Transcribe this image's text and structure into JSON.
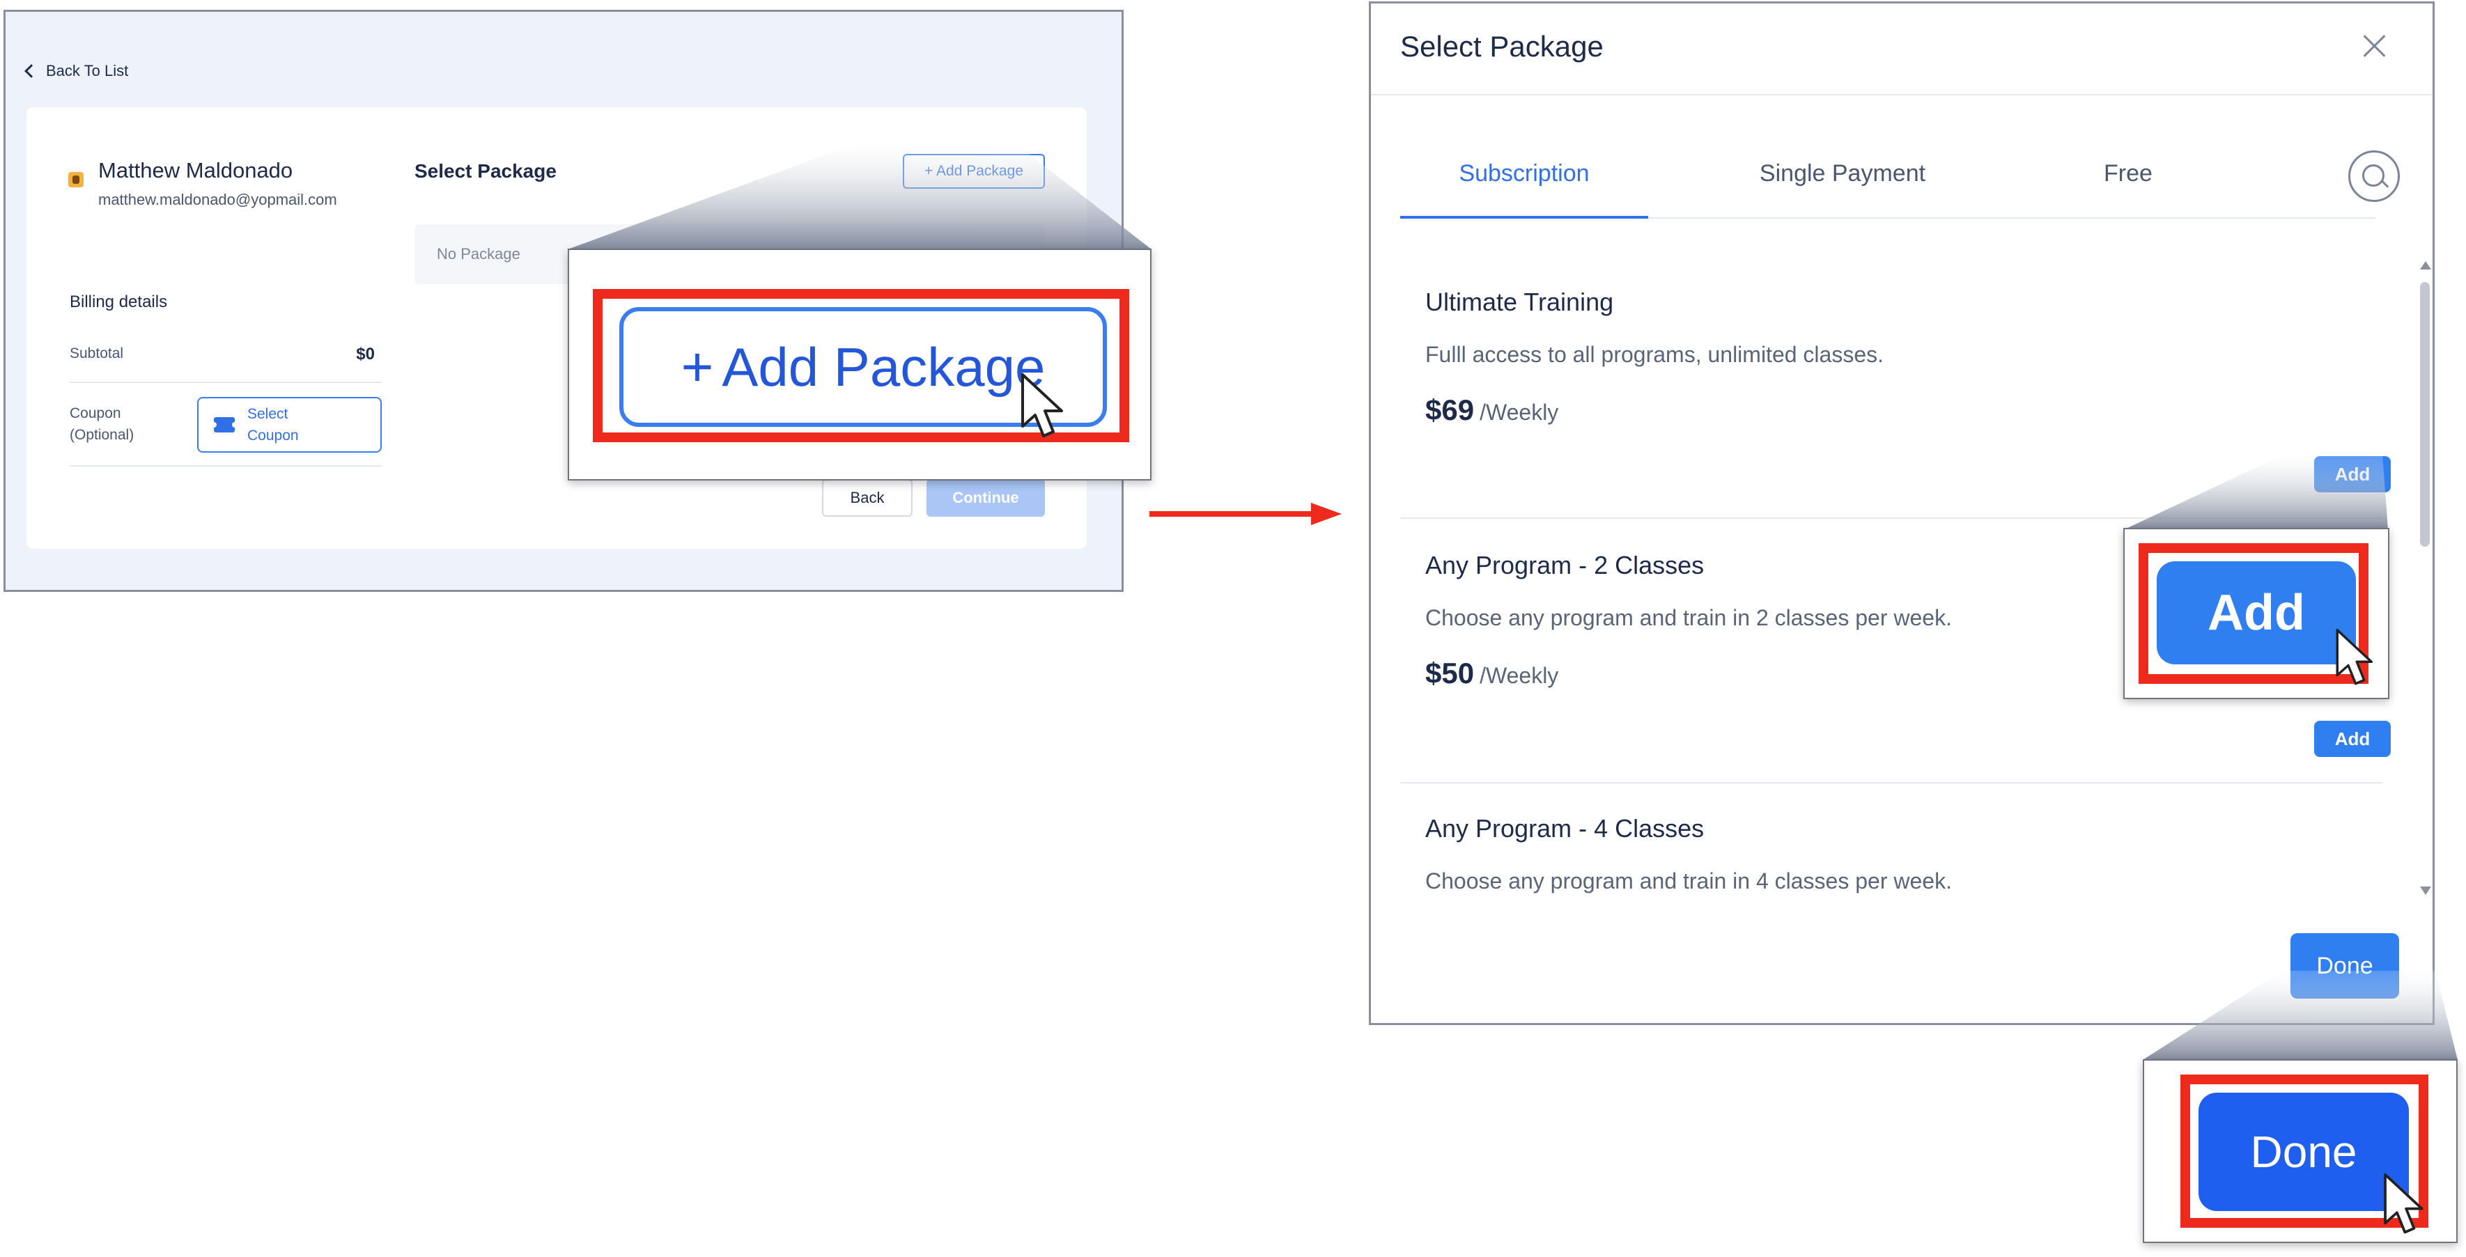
{
  "left_screen": {
    "back_link": "Back To List",
    "user": {
      "name": "Matthew Maldonado",
      "email": "matthew.maldonado@yopmail.com"
    },
    "billing": {
      "title": "Billing details",
      "subtotal_label": "Subtotal",
      "subtotal_value": "$0",
      "coupon_label": "Coupon (Optional)",
      "coupon_button": "Select Coupon"
    },
    "package_section": {
      "title": "Select Package",
      "add_button": "+ Add Package",
      "empty_text": "No Package"
    },
    "footer": {
      "back": "Back",
      "continue": "Continue"
    }
  },
  "zoom_add_package": {
    "plus": "+",
    "label": "Add Package"
  },
  "modal": {
    "title": "Select Package",
    "tabs": [
      {
        "label": "Subscription",
        "active": true
      },
      {
        "label": "Single Payment",
        "active": false
      },
      {
        "label": "Free",
        "active": false
      }
    ],
    "packages": [
      {
        "name": "Ultimate Training",
        "description": "Fulll access to all programs, unlimited classes.",
        "price": "$69",
        "period": "/Weekly",
        "add": "Add"
      },
      {
        "name": "Any Program - 2 Classes",
        "description": "Choose any program and train in 2 classes per week.",
        "price": "$50",
        "period": "/Weekly",
        "add": "Add"
      },
      {
        "name": "Any Program - 4 Classes",
        "description": "Choose any program and train in 4 classes per week."
      }
    ],
    "done": "Done"
  },
  "zoom_add": {
    "label": "Add"
  },
  "zoom_done": {
    "label": "Done"
  },
  "colors": {
    "accent": "#2f7ff0",
    "highlight_frame": "#ee2a1c",
    "text_dark": "#1e2a4a"
  }
}
